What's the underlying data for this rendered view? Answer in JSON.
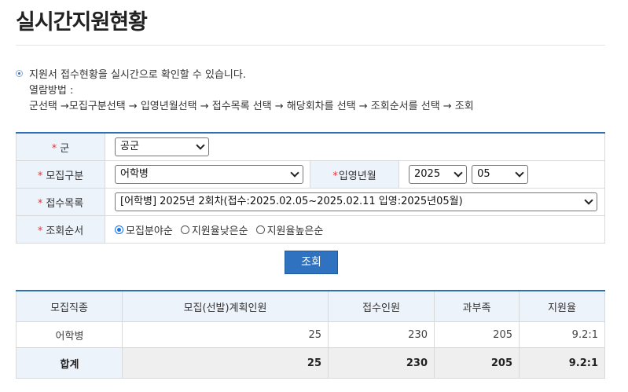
{
  "page": {
    "title": "실시간지원현황"
  },
  "guide": {
    "line1": "지원서 접수현황을 실시간으로 확인할 수 있습니다.",
    "line2": "열람방법 :",
    "line3": "군선택 →모집구분선택 → 입영년월선택 → 접수목록 선택 → 해당회차를 선택 → 조회순서를 선택 → 조회"
  },
  "form": {
    "branch_label": "군",
    "branch_value": "공군",
    "recruit_type_label": "모집구분",
    "recruit_type_value": "어학병",
    "enlist_label": "입영년월",
    "enlist_year": "2025",
    "enlist_month": "05",
    "receipt_list_label": "접수목록",
    "receipt_list_value": "[어학병] 2025년 2회차(접수:2025.02.05~2025.02.11 입영:2025년05월)",
    "order_label": "조회순서",
    "order_options": [
      "모집분야순",
      "지원율낮은순",
      "지원율높은순"
    ],
    "order_selected": "모집분야순",
    "required_mark": "*"
  },
  "search_button": "조회",
  "results": {
    "headers": [
      "모집직종",
      "모집(선발)계획인원",
      "접수인원",
      "과부족",
      "지원율"
    ],
    "rows": [
      [
        "어학병",
        "25",
        "230",
        "205",
        "9.2:1"
      ]
    ],
    "total": [
      "합계",
      "25",
      "230",
      "205",
      "9.2:1"
    ]
  },
  "colors": {
    "accent": "#2f6fb3",
    "button": "#2f73c0",
    "label_bg": "#edf3fb",
    "required": "#e33333"
  }
}
